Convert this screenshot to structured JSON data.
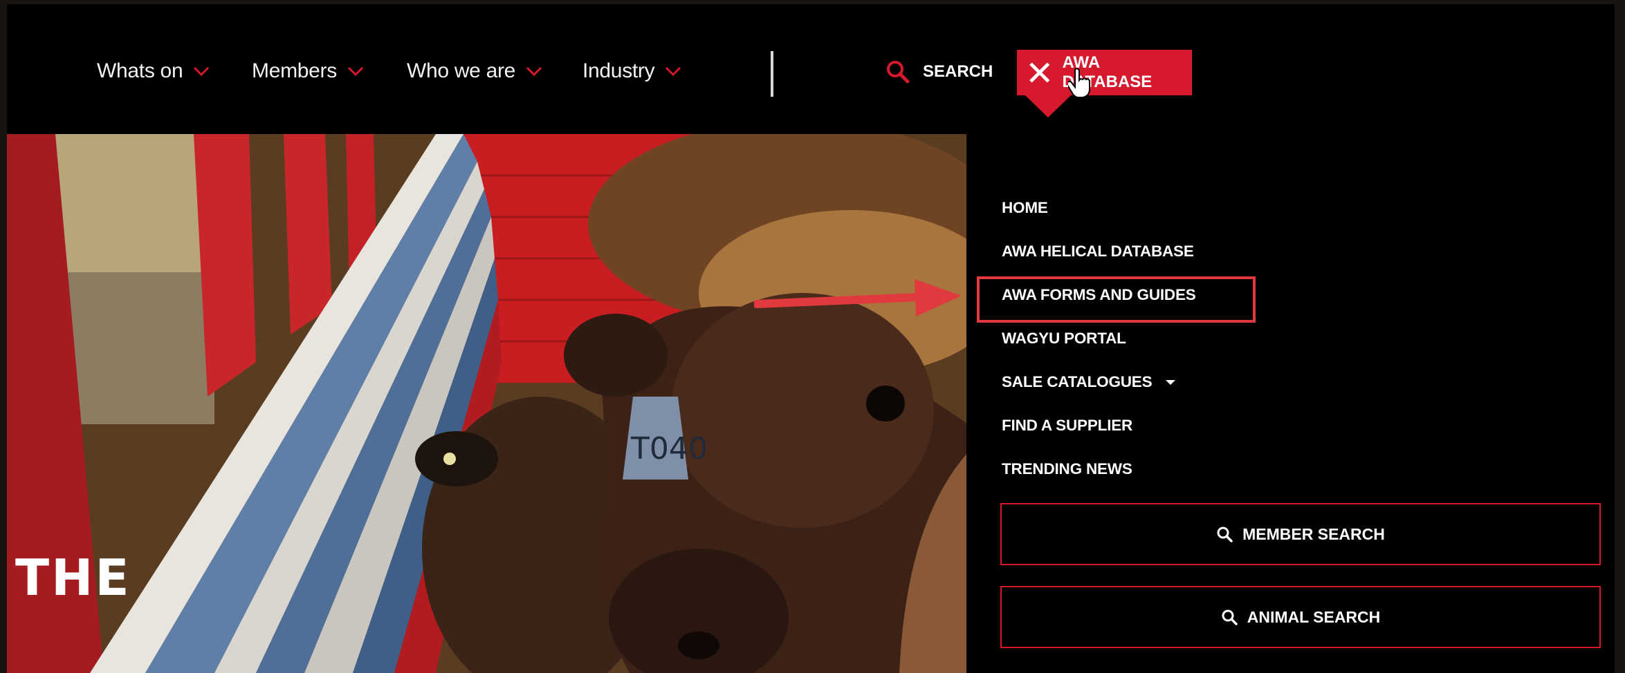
{
  "nav": {
    "items": [
      {
        "label": "Whats on"
      },
      {
        "label": "Members"
      },
      {
        "label": "Who we are"
      },
      {
        "label": "Industry"
      }
    ],
    "search_label": "SEARCH",
    "database_label": "AWA DATABASE"
  },
  "hero": {
    "word": "THE",
    "ear_tag": "T040"
  },
  "dropdown": {
    "items": [
      {
        "label": "HOME"
      },
      {
        "label": "AWA HELICAL DATABASE"
      },
      {
        "label": "AWA FORMS AND GUIDES"
      },
      {
        "label": "WAGYU PORTAL"
      },
      {
        "label": "SALE CATALOGUES"
      },
      {
        "label": "FIND A SUPPLIER"
      },
      {
        "label": "TRENDING NEWS"
      }
    ],
    "member_search_label": "MEMBER SEARCH",
    "animal_search_label": "ANIMAL SEARCH"
  },
  "colors": {
    "brand_red": "#d7192e",
    "annotation_red": "#e03a3e",
    "background": "#000000"
  },
  "icons": [
    "chevron-down-icon",
    "search-icon",
    "close-icon",
    "hand-cursor-icon",
    "caret-down-icon",
    "arrow-annotation"
  ]
}
